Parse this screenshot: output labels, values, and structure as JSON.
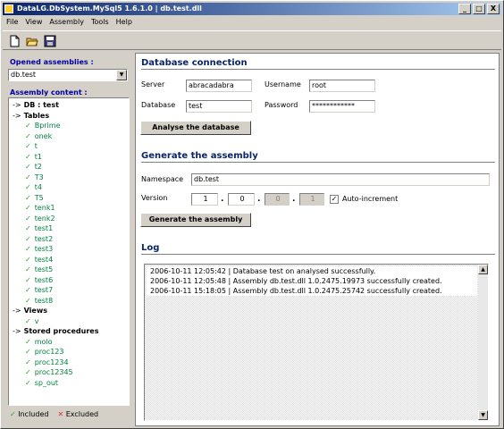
{
  "window": {
    "title": "DataLG.DbSystem.MySql5 1.6.1.0 | db.test.dll",
    "minimize": "_",
    "maximize": "□",
    "close": "X"
  },
  "menu": [
    "File",
    "View",
    "Assembly",
    "Tools",
    "Help"
  ],
  "toolbar": [
    "new-icon",
    "open-icon",
    "save-icon"
  ],
  "left": {
    "opened_label": "Opened assemblies :",
    "opened_value": "db.test",
    "content_label": "Assembly content :",
    "tree": [
      {
        "label": "DB : test",
        "level": 0
      },
      {
        "label": "Tables",
        "level": 0
      },
      {
        "label": "Bprime",
        "level": 1
      },
      {
        "label": "onek",
        "level": 1
      },
      {
        "label": "t",
        "level": 1
      },
      {
        "label": "t1",
        "level": 1
      },
      {
        "label": "t2",
        "level": 1
      },
      {
        "label": "T3",
        "level": 1
      },
      {
        "label": "t4",
        "level": 1
      },
      {
        "label": "T5",
        "level": 1
      },
      {
        "label": "tenk1",
        "level": 1
      },
      {
        "label": "tenk2",
        "level": 1
      },
      {
        "label": "test1",
        "level": 1
      },
      {
        "label": "test2",
        "level": 1
      },
      {
        "label": "test3",
        "level": 1
      },
      {
        "label": "test4",
        "level": 1
      },
      {
        "label": "test5",
        "level": 1
      },
      {
        "label": "test6",
        "level": 1
      },
      {
        "label": "test7",
        "level": 1
      },
      {
        "label": "test8",
        "level": 1
      },
      {
        "label": "Views",
        "level": 0
      },
      {
        "label": "v",
        "level": 1
      },
      {
        "label": "Stored procedures",
        "level": 0
      },
      {
        "label": "molo",
        "level": 1
      },
      {
        "label": "proc123",
        "level": 1
      },
      {
        "label": "proc1234",
        "level": 1
      },
      {
        "label": "proc12345",
        "level": 1
      },
      {
        "label": "sp_out",
        "level": 1
      }
    ],
    "legend_included": "Included",
    "legend_excluded": "Excluded"
  },
  "db": {
    "title": "Database connection",
    "server_label": "Server",
    "server_value": "abracadabra",
    "username_label": "Username",
    "username_value": "root",
    "database_label": "Database",
    "database_value": "test",
    "password_label": "Password",
    "password_value": "************",
    "analyse_button": "Analyse the database"
  },
  "gen": {
    "title": "Generate the assembly",
    "namespace_label": "Namespace",
    "namespace_value": "db.test",
    "version_label": "Version",
    "v1": "1",
    "v2": "0",
    "v3": "0",
    "v4": "1",
    "autoinc_label": "Auto-increment",
    "autoinc_checked": "✓",
    "generate_button": "Generate the assembly"
  },
  "log": {
    "title": "Log",
    "lines": [
      "2006-10-11 12:05:42 | Database test on                          analysed successfully.",
      "2006-10-11 12:05:48 | Assembly db.test.dll 1.0.2475.19973 successfully created.",
      "2006-10-11 15:18:05 | Assembly db.test.dll 1.0.2475.25742 successfully created."
    ]
  }
}
